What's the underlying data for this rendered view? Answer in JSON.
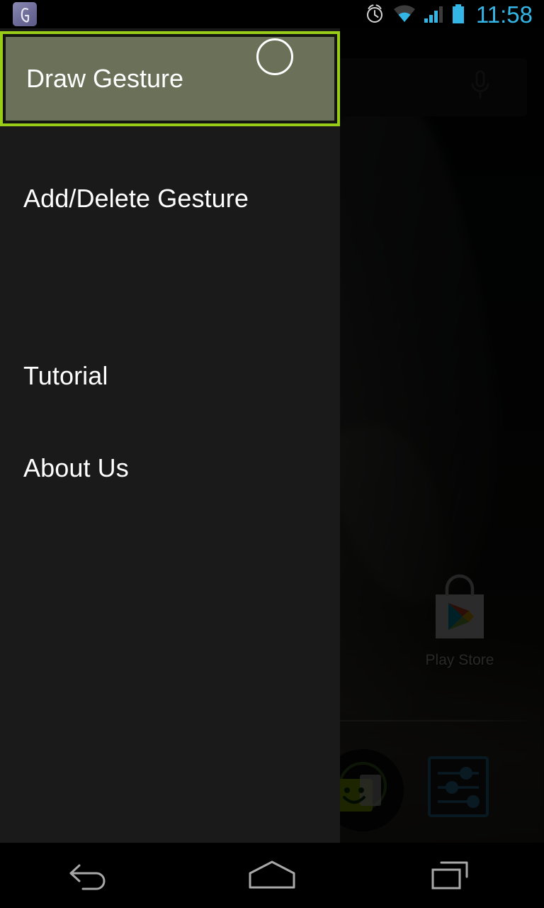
{
  "status_bar": {
    "app_icon": "gesture-app-icon",
    "icons": [
      "alarm-clock-icon",
      "wifi-icon",
      "cellular-signal-icon",
      "battery-icon"
    ],
    "time": "11:58",
    "time_color": "#33b5e5"
  },
  "drawer": {
    "background_color": "#1a1a1a",
    "items": [
      {
        "label": "Draw Gesture",
        "name": "draw-gesture",
        "selected": true
      },
      {
        "label": "Add/Delete Gesture",
        "name": "add-delete-gesture",
        "selected": false
      },
      {
        "label": "Tutorial",
        "name": "tutorial",
        "selected": false
      },
      {
        "label": "About Us",
        "name": "about-us",
        "selected": false
      }
    ],
    "highlight": {
      "border_color": "#9acd18",
      "inner_border_color": "#131511",
      "fill_color": "#6b7158",
      "touch_indicator": "circle-touch-indicator"
    }
  },
  "home_screen": {
    "search_widget": {
      "placeholder": "",
      "mic_icon": "microphone-icon"
    },
    "app_icons": [
      {
        "label": "Play Store",
        "name": "play-store"
      }
    ],
    "dock": [
      {
        "label": "",
        "name": "all-apps"
      },
      {
        "label": "",
        "name": "settings"
      }
    ]
  },
  "nav_bar": {
    "buttons": [
      {
        "label": "",
        "name": "back-button"
      },
      {
        "label": "",
        "name": "home-button"
      },
      {
        "label": "",
        "name": "recents-button"
      }
    ],
    "icon_color": "#a8a8a8"
  }
}
